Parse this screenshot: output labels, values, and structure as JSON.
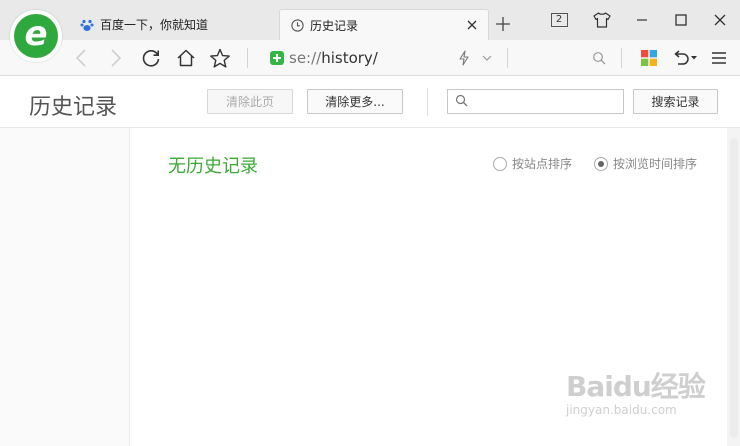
{
  "tabs": [
    {
      "title": "百度一下，你就知道",
      "icon": "baidu-paw-icon",
      "active": false
    },
    {
      "title": "历史记录",
      "icon": "clock-icon",
      "active": true
    }
  ],
  "window": {
    "tab_count": "2"
  },
  "address": {
    "scheme": "se://",
    "path": "history/"
  },
  "header": {
    "title": "历史记录",
    "clear_page": "清除此页",
    "clear_more": "清除更多...",
    "search_placeholder": "",
    "search_button": "搜索记录"
  },
  "content": {
    "empty_message": "无历史记录"
  },
  "sort": {
    "by_site": "按站点排序",
    "by_time": "按浏览时间排序",
    "selected": "by_time"
  },
  "watermark": {
    "main": "Baidu经验",
    "sub": "jingyan.baidu.com"
  },
  "colors": {
    "brand_green": "#2fa93d",
    "empty_text": "#3aaa35"
  }
}
